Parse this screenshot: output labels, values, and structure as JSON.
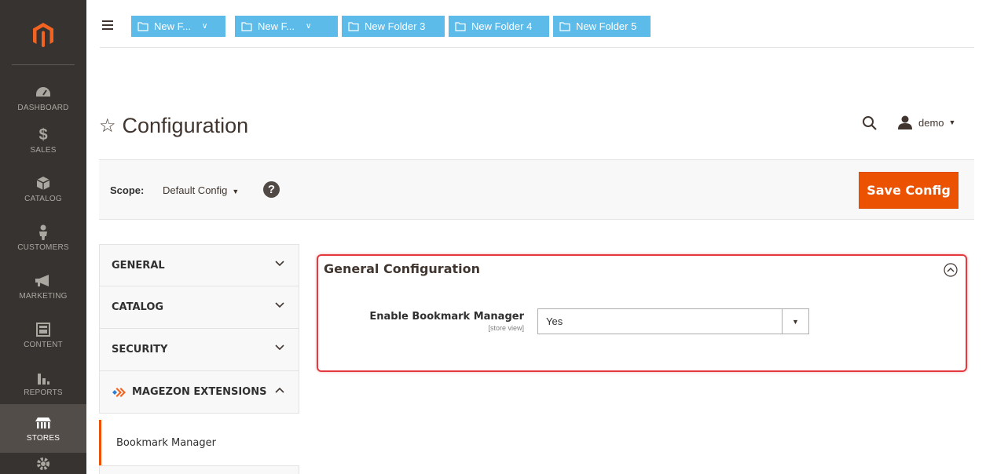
{
  "nav": {
    "items": [
      {
        "label": "DASHBOARD",
        "icon": "dashboard-icon"
      },
      {
        "label": "SALES",
        "icon": "dollar-icon"
      },
      {
        "label": "CATALOG",
        "icon": "box-icon"
      },
      {
        "label": "CUSTOMERS",
        "icon": "person-icon"
      },
      {
        "label": "MARKETING",
        "icon": "megaphone-icon"
      },
      {
        "label": "CONTENT",
        "icon": "layout-icon"
      },
      {
        "label": "REPORTS",
        "icon": "bar-chart-icon"
      },
      {
        "label": "STORES",
        "icon": "store-icon"
      }
    ]
  },
  "bookmarks": {
    "folders": [
      {
        "label": "New F...",
        "has_dropdown": true
      },
      {
        "label": "New F...",
        "has_dropdown": true
      },
      {
        "label": "New Folder 3",
        "has_dropdown": false
      },
      {
        "label": "New Folder 4",
        "has_dropdown": false
      },
      {
        "label": "New Folder 5",
        "has_dropdown": false
      }
    ],
    "color": "#5cbbe9"
  },
  "header": {
    "title": "Configuration",
    "user": "demo"
  },
  "scope": {
    "label": "Scope:",
    "value": "Default Config",
    "help": "?"
  },
  "actions": {
    "save_label": "Save Config",
    "accent": "#eb5202"
  },
  "tabs": {
    "items": [
      {
        "label": "GENERAL"
      },
      {
        "label": "CATALOG"
      },
      {
        "label": "SECURITY"
      },
      {
        "label": "MAGEZON EXTENSIONS"
      }
    ],
    "active_child": "Bookmark Manager"
  },
  "general_config": {
    "title": "General Configuration",
    "field_label": "Enable Bookmark Manager",
    "field_scope": "[store view]",
    "field_value": "Yes",
    "highlight_color": "#e3393f"
  }
}
